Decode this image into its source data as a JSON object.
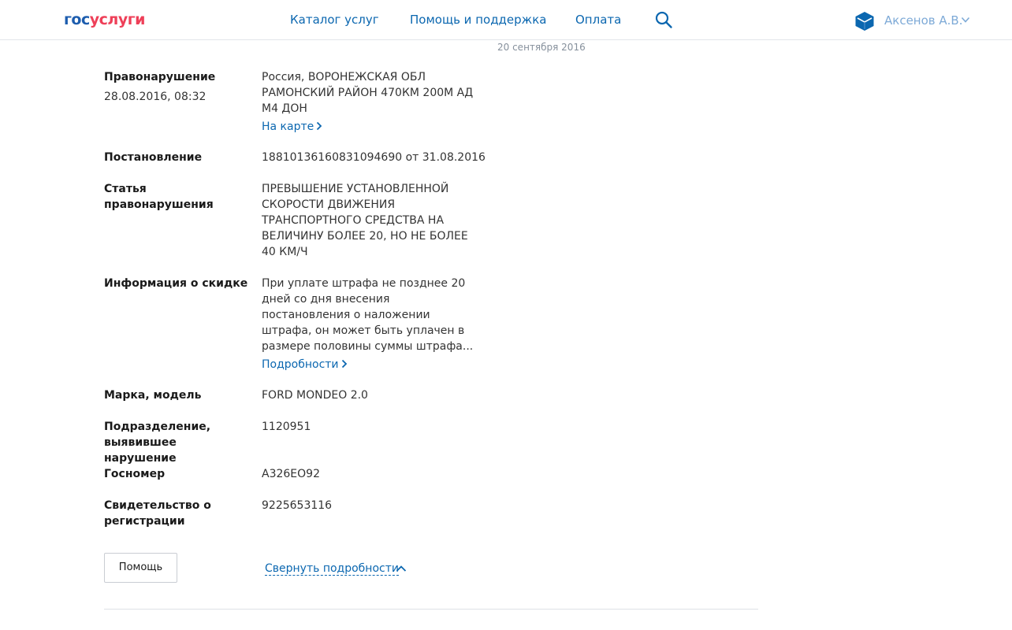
{
  "header": {
    "logo_part1": "гос",
    "logo_part2": "услуги",
    "nav": [
      {
        "label": "Каталог услуг"
      },
      {
        "label": "Помощь и поддержка"
      },
      {
        "label": "Оплата"
      }
    ],
    "user_name": "Аксенов А.В."
  },
  "top_partial_date": "20 сентября 2016",
  "details": {
    "offense": {
      "label": "Правонарушение",
      "datetime": "28.08.2016, 08:32",
      "location": "Россия, ВОРОНЕЖСКАЯ ОБЛ РАМОНСКИЙ РАЙОН 470КМ 200М АД М4 ДОН",
      "map_link": "На карте"
    },
    "resolution": {
      "label": "Постановление",
      "value": "18810136160831094690 от 31.08.2016"
    },
    "article": {
      "label": "Статья правонарушения",
      "value": "ПРЕВЫШЕНИЕ УСТАНОВЛЕННОЙ СКОРОСТИ ДВИЖЕНИЯ ТРАНСПОРТНОГО СРЕДСТВА НА ВЕЛИЧИНУ БОЛЕЕ 20, НО НЕ БОЛЕЕ 40 КМ/Ч"
    },
    "discount": {
      "label": "Информация о скидке",
      "value": "При уплате штрафа не позднее 20 дней со дня внесения постановления о наложении штрафа, он может быть уплачен в размере половины суммы штрафа...",
      "more_link": "Подробности"
    },
    "car": {
      "label": "Марка, модель",
      "value": "FORD MONDEO 2.0"
    },
    "department": {
      "label": "Подразделение, выявившее нарушение",
      "value": "1120951"
    },
    "plate": {
      "label": "Госномер",
      "value": "А326ЕО92"
    },
    "certificate": {
      "label": "Свидетельство о регистрации",
      "value": "9225653116"
    }
  },
  "actions": {
    "help_button": "Помощь",
    "collapse_link": "Свернуть подробности"
  },
  "colors": {
    "link": "#0b67b0",
    "logo_blue": "#1d5dae",
    "logo_red": "#ee3f58",
    "user_name": "#7eaad7"
  },
  "icons": {
    "search": "search-icon",
    "user": "user-avatar-icon",
    "user_menu": "chevron-down-icon",
    "link_arrow": "chevron-right-icon",
    "collapse": "chevron-up-icon"
  }
}
